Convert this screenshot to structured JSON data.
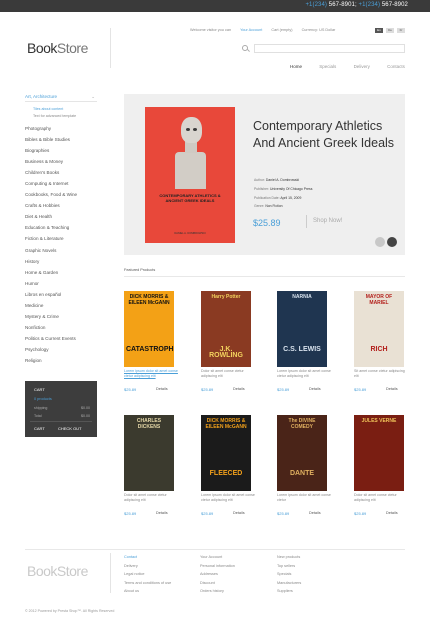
{
  "topbar": {
    "phone1_prefix": "+1(234)",
    "phone1": " 567-8901;",
    "phone2_prefix": "+1(234)",
    "phone2": " 567-8902"
  },
  "header": {
    "logo_bold": "Book",
    "logo_light": "Store",
    "links": [
      "Welcome visitor you can",
      "Your Account",
      "Cart (empty)",
      "Currency: US Dollar"
    ],
    "languages": [
      "En",
      "De",
      "Fr"
    ],
    "search_placeholder": ""
  },
  "nav": [
    "Home",
    "Specials",
    "Delivery",
    "Contacts"
  ],
  "sidebar": {
    "open_category": "Art, Architecture",
    "sub_items": [
      "Tiles about content",
      "Text for advanced template"
    ],
    "categories": [
      "Photography",
      "Bibles & Bible Studies",
      "Biographies",
      "Business & Money",
      "Children's Books",
      "Computing & Internet",
      "Cookbooks, Food & Wine",
      "Crafts & Hobbies",
      "Diet & Health",
      "Education & Teaching",
      "Fiction & Literature",
      "Graphic Novels",
      "History",
      "Home & Garden",
      "Humor",
      "Libros en español",
      "Medicine",
      "Mystery & Crime",
      "Nonfiction",
      "Politics & Current Events",
      "Psychology",
      "Religion"
    ]
  },
  "cart": {
    "title": "CART",
    "subtitle": "0 products",
    "shipping_label": "shipping",
    "shipping_value": "$0.00",
    "total_label": "Total",
    "total_value": "$0.00",
    "cart_button": "CART",
    "checkout_button": "CHECK OUT"
  },
  "hero": {
    "book_title": "CONTEMPORARY ATHLETICS & ANCIENT GREEK IDEALS",
    "book_author": "DANIEL A. DOMBROWSKI",
    "title": "Contemporary Athletics And Ancient Greek Ideals",
    "author_label": "Author:",
    "author": "Daniel A. Dombrowski",
    "publisher_label": "Publisher:",
    "publisher": "University Of Chicago Press",
    "date_label": "Publication Date:",
    "date": "April 15, 2009",
    "genre_label": "Genre:",
    "genre": "Non Fiction",
    "price": "$25.89",
    "shop_label": "Shop Now!"
  },
  "featured": {
    "label": "Featured Products",
    "products": [
      {
        "cover_text": "DICK MORRIS & EILEEN McGANN",
        "cover_sub": "CATASTROPHE",
        "desc": "Lorem ipsum dolor sit amet conse ctetur adipiscing elit",
        "price": "$25.89",
        "details": "Details",
        "bg": "#f3a116",
        "fg": "#111111"
      },
      {
        "cover_text": "Harry Potter",
        "cover_sub": "J.K. ROWLING",
        "desc": "Dolor sit amet conse ctetur adipiscing elit",
        "price": "$25.89",
        "details": "Details",
        "bg": "#8a3a22",
        "fg": "#f4d35e"
      },
      {
        "cover_text": "NARNIA",
        "cover_sub": "C.S. LEWIS",
        "desc": "Lorem ipsum dolor sit amet conse ctetur adipiscing elit",
        "price": "$25.89",
        "details": "Details",
        "bg": "#1f3550",
        "fg": "#d9e3ee"
      },
      {
        "cover_text": "MAYOR OF MARIEL",
        "cover_sub": "RICH",
        "desc": "Sit amet conse ctetur adipiscing elit",
        "price": "$25.89",
        "details": "Details",
        "bg": "#e9e1d4",
        "fg": "#b3201c"
      },
      {
        "cover_text": "CHARLES DICKENS",
        "cover_sub": "",
        "desc": "Dolor sit amet conse ctetur adipiscing elit",
        "price": "$25.89",
        "details": "Details",
        "bg": "#3b3a2e",
        "fg": "#e6d9a8"
      },
      {
        "cover_text": "DICK MORRIS & EILEEN McGANN",
        "cover_sub": "FLEECED",
        "desc": "Lorem ipsum dolor sit amet conse ctetur adipiscing elit",
        "price": "$25.89",
        "details": "Details",
        "bg": "#1b1b1b",
        "fg": "#f2a01a"
      },
      {
        "cover_text": "The DIVINE COMEDY",
        "cover_sub": "DANTE",
        "desc": "Lorem ipsum dolor sit amet conse ctetur",
        "price": "$25.89",
        "details": "Details",
        "bg": "#4a2418",
        "fg": "#e0b060"
      },
      {
        "cover_text": "JULES VERNE",
        "cover_sub": "",
        "desc": "Dolor sit amet conse ctetur adipiscing elit",
        "price": "$25.89",
        "details": "Details",
        "bg": "#7a1e12",
        "fg": "#f0c35a"
      }
    ]
  },
  "footer": {
    "logo_bold": "Book",
    "logo_light": "Store",
    "col1": [
      "Contact",
      "Delivery",
      "Legal notice",
      "Terms and conditions of use",
      "About us"
    ],
    "col2": [
      "Your Account",
      "Personal information",
      "Addresses",
      "Discount",
      "Orders history"
    ],
    "col3": [
      "New products",
      "Top sellers",
      "Specials",
      "Manufacturers",
      "Suppliers"
    ],
    "copyright": "© 2012 Powered by Presta Shop™. All Rights Reserved"
  },
  "colors": {
    "accent": "#4a9fd8",
    "dark": "#3d3d3d",
    "hero_bg": "#efefef",
    "hero_book": "#e8483a"
  }
}
